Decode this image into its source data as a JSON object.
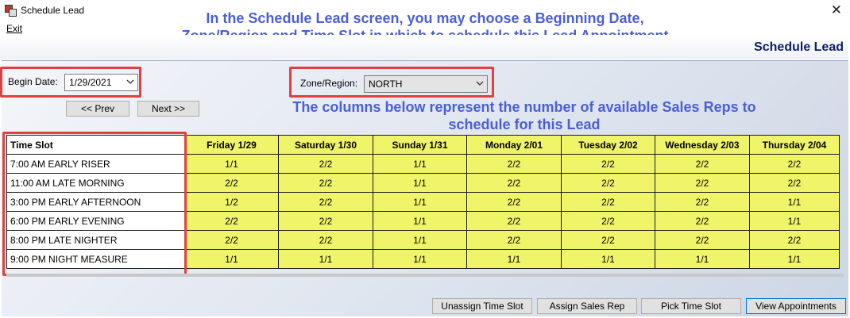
{
  "window": {
    "title": "Schedule Lead",
    "close_symbol": "✕"
  },
  "menu": {
    "exit_label": "Exit"
  },
  "caption_lines": [
    "In the Schedule Lead screen, you may choose a Beginning Date,",
    "Zone/Region and Time Slot in which to schedule this Lead Appointment"
  ],
  "header": {
    "title": "Schedule Lead"
  },
  "filters": {
    "begin_date_label": "Begin Date:",
    "begin_date_value": "1/29/2021",
    "zone_label": "Zone/Region:",
    "zone_value": "NORTH"
  },
  "nav": {
    "prev_label": "<< Prev",
    "next_label": "Next >>"
  },
  "note_lines": [
    "The columns below represent the number of available Sales Reps to",
    "schedule for this Lead"
  ],
  "grid": {
    "columns": [
      "Time Slot",
      "Friday 1/29",
      "Saturday 1/30",
      "Sunday 1/31",
      "Monday 2/01",
      "Tuesday 2/02",
      "Wednesday 2/03",
      "Thursday 2/04"
    ],
    "rows": [
      [
        "7:00 AM EARLY RISER",
        "1/1",
        "2/2",
        "1/1",
        "2/2",
        "2/2",
        "2/2",
        "2/2"
      ],
      [
        "11:00 AM LATE MORNING",
        "2/2",
        "2/2",
        "1/1",
        "2/2",
        "2/2",
        "2/2",
        "2/2"
      ],
      [
        "3:00 PM EARLY AFTERNOON",
        "1/2",
        "2/2",
        "1/1",
        "2/2",
        "2/2",
        "2/2",
        "1/1"
      ],
      [
        "6:00 PM EARLY EVENING",
        "2/2",
        "2/2",
        "1/1",
        "2/2",
        "2/2",
        "2/2",
        "1/1"
      ],
      [
        "8:00 PM LATE NIGHTER",
        "2/2",
        "2/2",
        "1/1",
        "2/2",
        "2/2",
        "2/2",
        "2/2"
      ],
      [
        "9:00 PM NIGHT MEASURE",
        "1/1",
        "1/1",
        "1/1",
        "1/1",
        "1/1",
        "1/1",
        "1/1"
      ]
    ]
  },
  "actions": {
    "unassign_label": "Unassign Time Slot",
    "assign_label": "Assign Sales Rep",
    "pick_label": "Pick Time Slot",
    "view_label": "View Appointments"
  },
  "colors": {
    "highlight": "#e0413f",
    "caption": "#4a5fd6",
    "grid_cell": "#f0f468",
    "header_title": "#0d1e66"
  }
}
